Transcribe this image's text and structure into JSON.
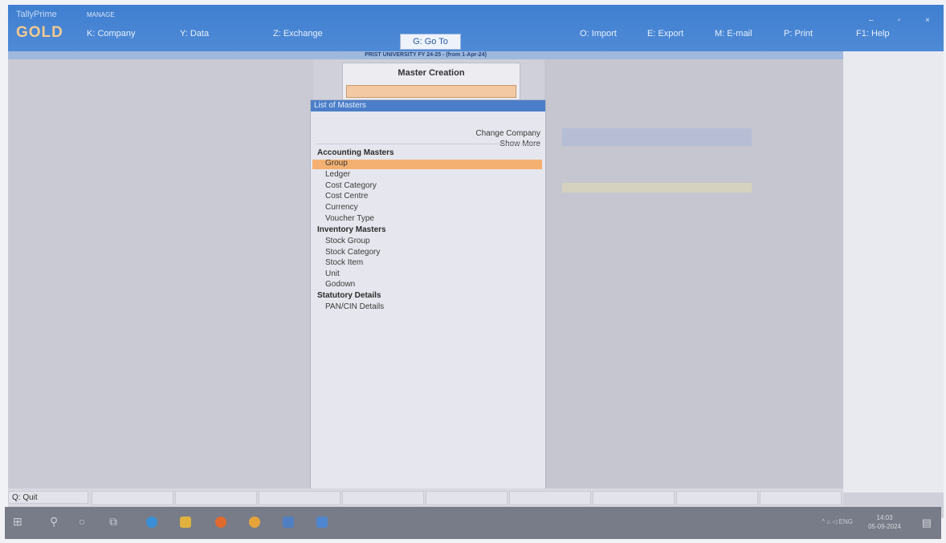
{
  "app": {
    "brand_top": "TallyPrime",
    "brand_edition": "GOLD",
    "manage_label": "MANAGE"
  },
  "menu": {
    "company": "K: Company",
    "data": "Y: Data",
    "exchange": "Z: Exchange",
    "goto": "G: Go To",
    "import": "O: Import",
    "export": "E: Export",
    "email": "M: E-mail",
    "print": "P: Print",
    "help": "F1: Help"
  },
  "window_controls": {
    "minimize": "–",
    "maximize": "▫",
    "close": "×"
  },
  "company_strip": "PRIST UNIVERSITY FY 24-25 - (from 1-Apr-24)",
  "master_creation": {
    "title": "Master Creation",
    "input_value": ""
  },
  "list_of_masters": {
    "header": "List of Masters",
    "change_company": "Change Company",
    "show_more": "Show More",
    "accounting_section": "Accounting Masters",
    "accounting_items": [
      "Group",
      "Ledger",
      "Cost Category",
      "Cost Centre",
      "Currency",
      "Voucher Type"
    ],
    "inventory_section": "Inventory Masters",
    "inventory_items": [
      "Stock Group",
      "Stock Category",
      "Stock Item",
      "Unit",
      "Godown"
    ],
    "statutory_section": "Statutory Details",
    "statutory_items": [
      "PAN/CIN Details"
    ],
    "selected_item": "Group"
  },
  "bottom_bar": {
    "quit": "Q: Quit"
  },
  "taskbar": {
    "date": "05-09-2024",
    "time": "14:03",
    "lang": "ENG"
  },
  "colors": {
    "accent": "#4b7ec8",
    "selection": "#f4b071",
    "gold": "#f3c98e"
  }
}
